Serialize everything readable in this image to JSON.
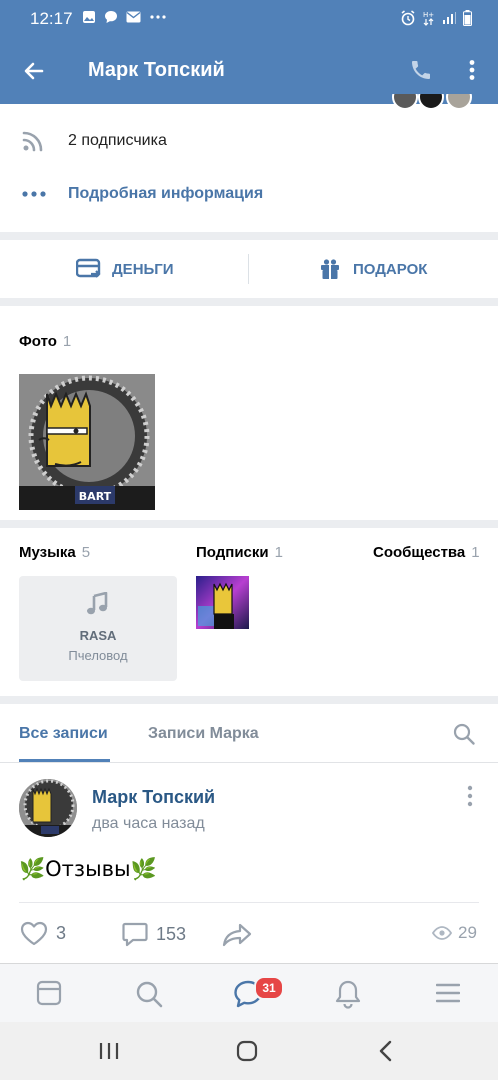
{
  "status_bar": {
    "time": "12:17",
    "left_icons": [
      "image-icon",
      "chat-icon",
      "mail-icon",
      "more-dots-icon"
    ],
    "right_icons": [
      "alarm-icon",
      "network-icon",
      "signal-icon",
      "battery-icon"
    ]
  },
  "header": {
    "title": "Марк Топский"
  },
  "info": {
    "subscribers": "2 подписчика",
    "details_link": "Подробная информация"
  },
  "actions": {
    "money_label": "ДЕНЬГИ",
    "gift_label": "ПОДАРОК"
  },
  "photos": {
    "label": "Фото",
    "count": "1"
  },
  "media": {
    "music_label": "Музыка",
    "music_count": "5",
    "track_title": "RASA",
    "track_subtitle": "Пчеловод",
    "subscriptions_label": "Подписки",
    "subscriptions_count": "1",
    "communities_label": "Сообщества",
    "communities_count": "1"
  },
  "wall_tabs": {
    "all_posts": "Все записи",
    "author_posts": "Записи Марка"
  },
  "post": {
    "author": "Марк Топский",
    "time": "два часа назад",
    "text": "🌿Отзывы🌿",
    "likes": "3",
    "comments": "153",
    "views": "29"
  },
  "bottom_tabs": {
    "messages_badge": "31"
  },
  "colors": {
    "brand": "#5181b8",
    "link": "#4a76a8",
    "badge": "#e64646"
  }
}
